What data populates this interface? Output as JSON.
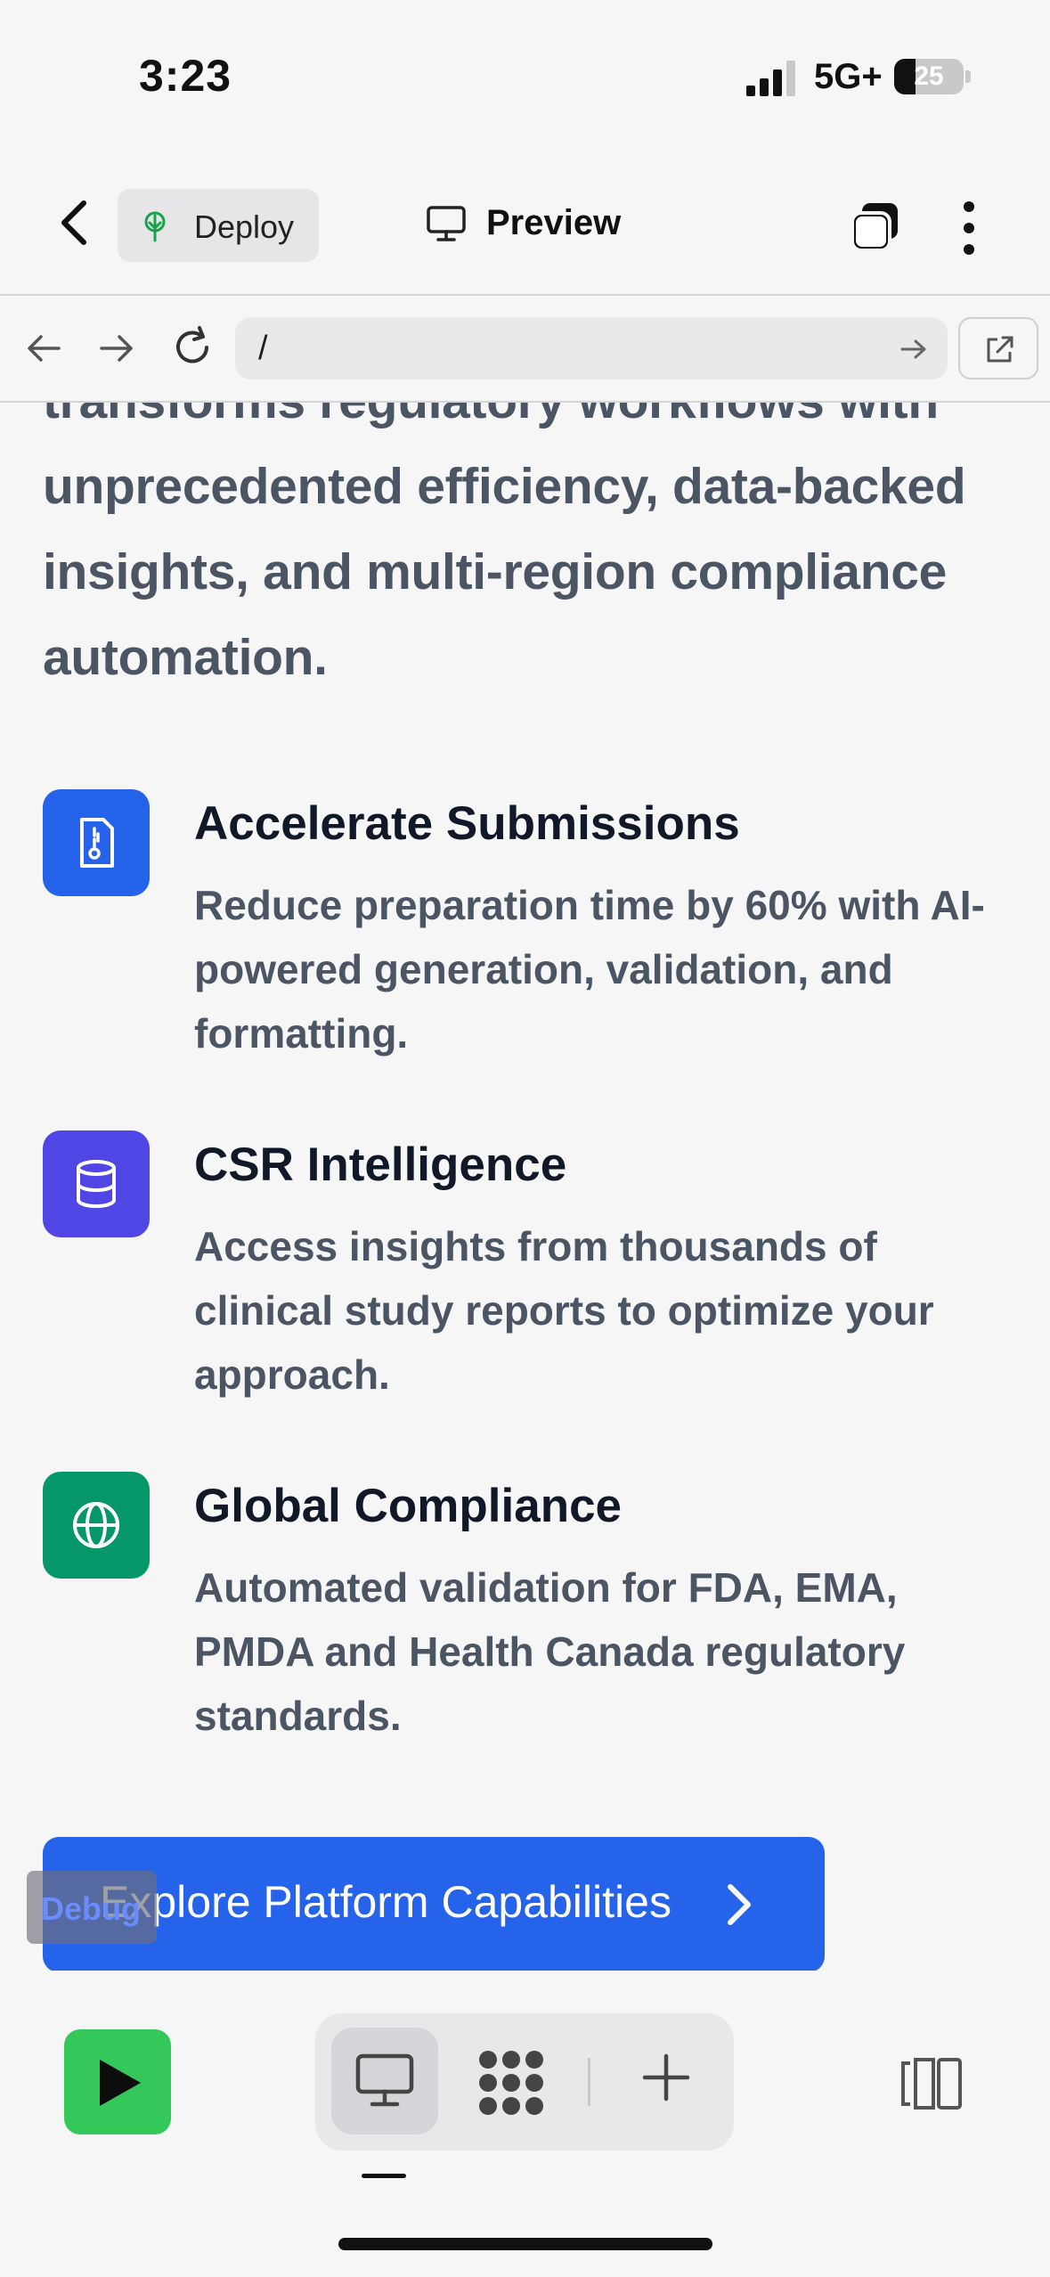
{
  "status": {
    "time": "3:23",
    "network": "5G+",
    "battery": "25"
  },
  "toolbar": {
    "deploy_label": "Deploy",
    "preview_label": "Preview"
  },
  "urlbar": {
    "path": "/"
  },
  "page": {
    "intro": "transforms regulatory workflows with unprecedented efficiency, data-backed insights, and multi-region compliance automation.",
    "features": [
      {
        "title": "Accelerate Submissions",
        "description": "Reduce preparation time by 60% with AI-powered generation, validation, and formatting.",
        "icon": "file-icon",
        "color": "#2563eb"
      },
      {
        "title": "CSR Intelligence",
        "description": "Access insights from thousands of clinical study reports to optimize your approach.",
        "icon": "database-icon",
        "color": "#4f46e5"
      },
      {
        "title": "Global Compliance",
        "description": "Automated validation for FDA, EMA, PMDA and Health Canada regulatory standards.",
        "icon": "globe-icon",
        "color": "#059669"
      }
    ],
    "cta_label": "Explore Platform Capabilities",
    "debug_label": "Debug"
  },
  "colors": {
    "accent": "#2563eb",
    "run": "#34c759"
  }
}
